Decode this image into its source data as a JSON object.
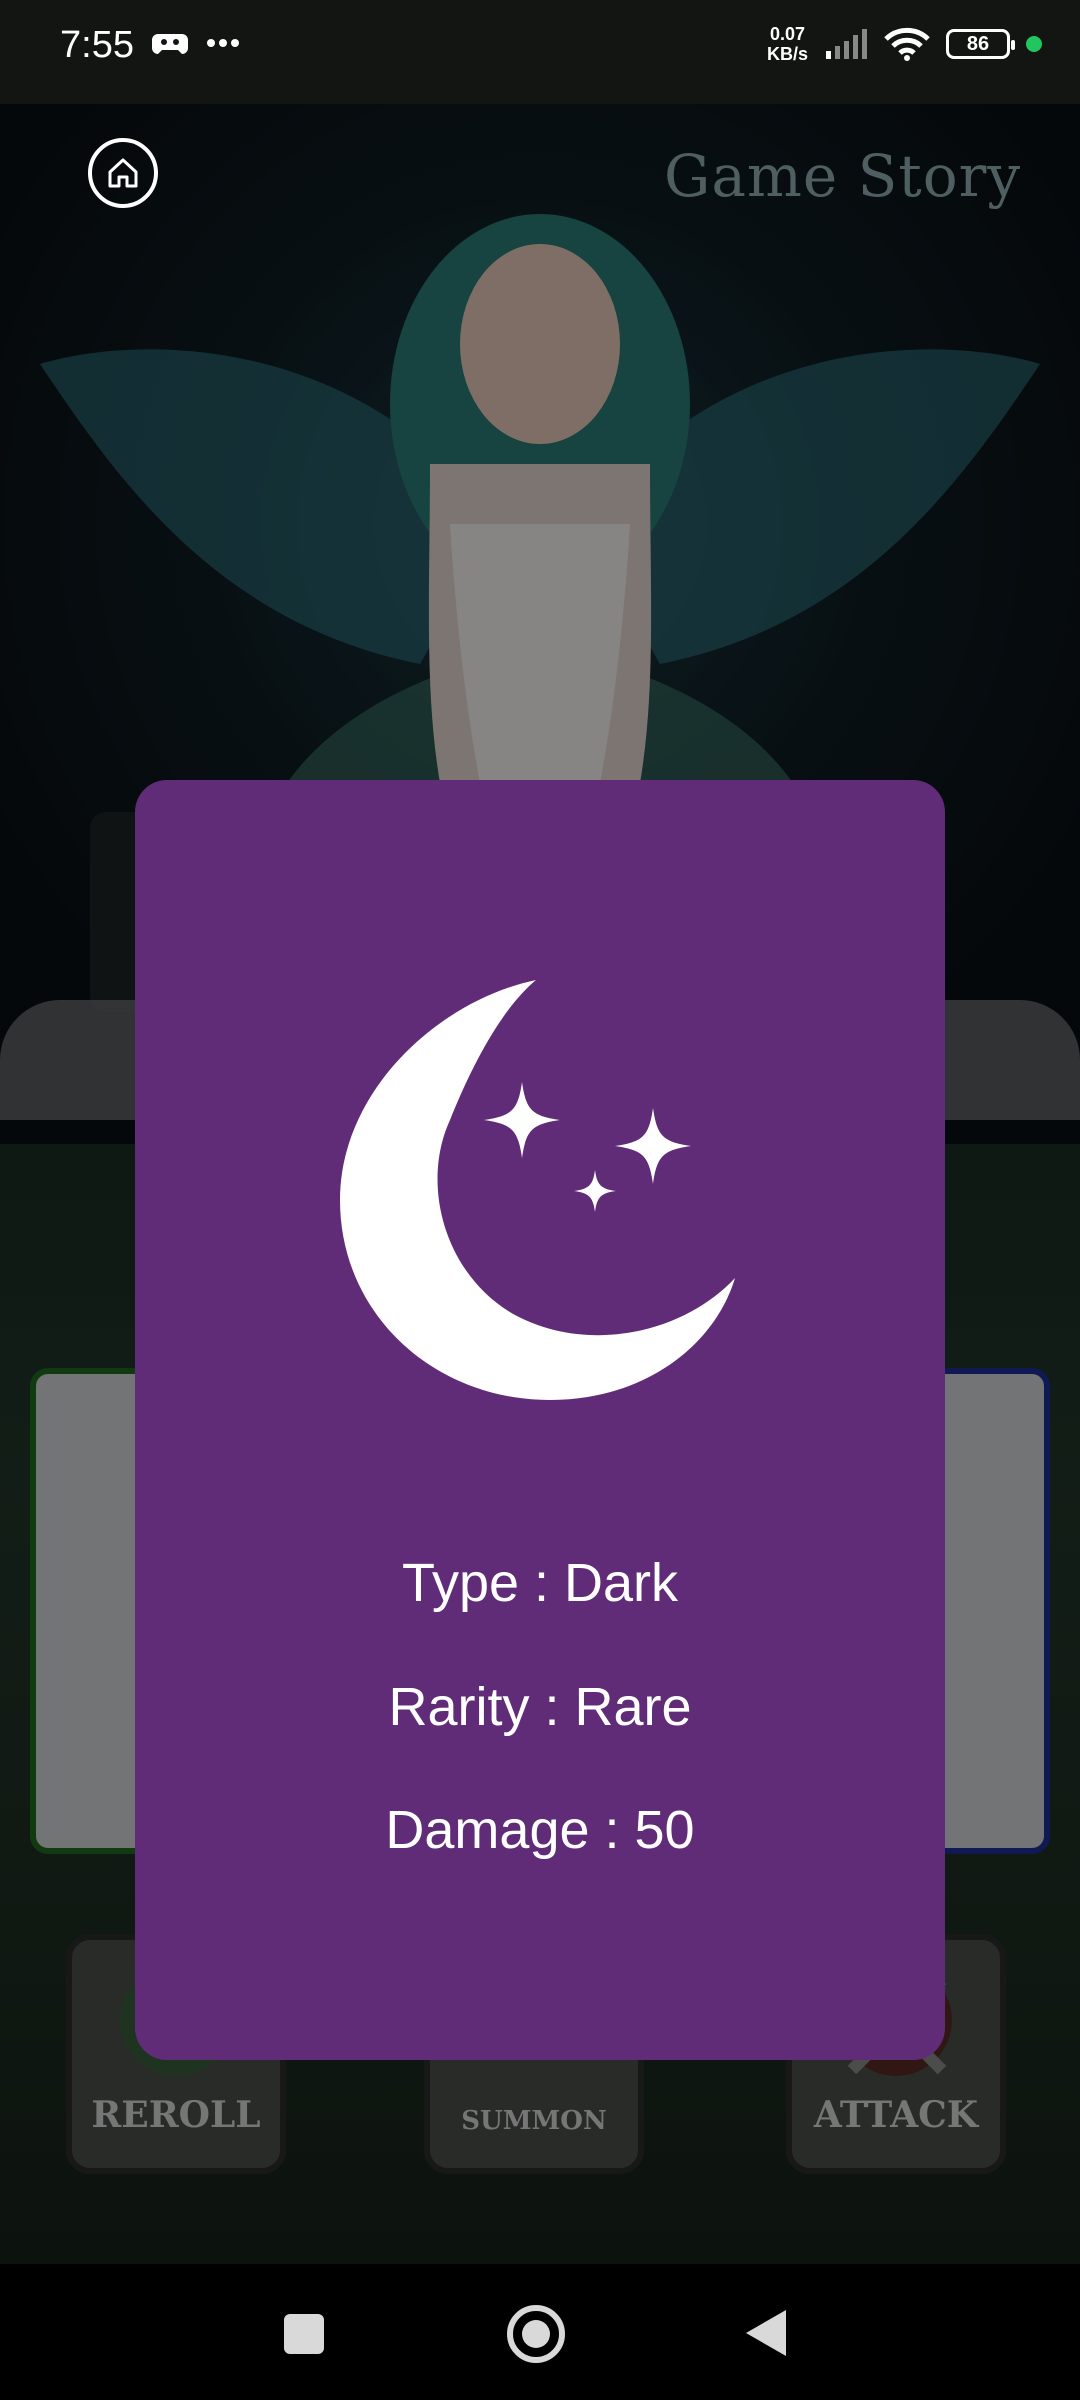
{
  "status_bar": {
    "time": "7:55",
    "net_speed_value": "0.07",
    "net_speed_unit": "KB/s",
    "battery": "86"
  },
  "header": {
    "title": "Game Story"
  },
  "buttons": {
    "reroll": "REROLL",
    "summon": "SUMMON",
    "attack": "ATTACK"
  },
  "card": {
    "icon": "moon-stars-icon",
    "type": "Type : Dark",
    "rarity": "Rarity : Rare",
    "damage": "Damage : 50",
    "color": "#602c78"
  }
}
